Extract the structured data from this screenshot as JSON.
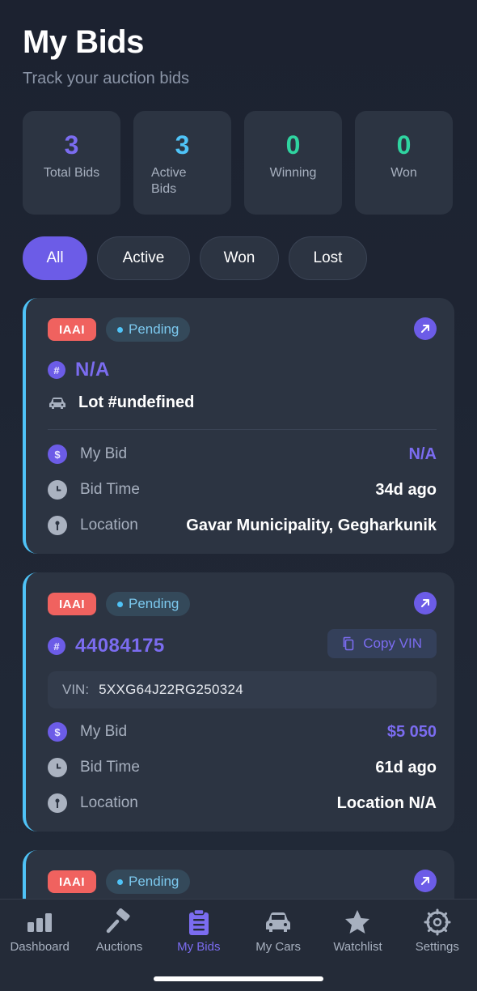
{
  "header": {
    "title": "My Bids",
    "subtitle": "Track your auction bids"
  },
  "stats": [
    {
      "value": "3",
      "label": "Total Bids",
      "color": "#7b6cf0"
    },
    {
      "value": "3",
      "label": "Active Bids",
      "color": "#4fc3f7"
    },
    {
      "value": "0",
      "label": "Winning",
      "color": "#2fd4a0"
    },
    {
      "value": "0",
      "label": "Won",
      "color": "#2fd4a0"
    }
  ],
  "filters": {
    "all": "All",
    "active": "Active",
    "won": "Won",
    "lost": "Lost",
    "selected": "All"
  },
  "bids": [
    {
      "auction": "IAAI",
      "status": "Pending",
      "id": "N/A",
      "lot": "Lot #undefined",
      "my_bid_label": "My Bid",
      "my_bid": "N/A",
      "bid_time_label": "Bid Time",
      "bid_time": "34d ago",
      "location_label": "Location",
      "location": "Gavar Municipality, Gegharkunik"
    },
    {
      "auction": "IAAI",
      "status": "Pending",
      "id": "44084175",
      "copy_label": "Copy VIN",
      "vin_label": "VIN:",
      "vin": "5XXG64J22RG250324",
      "my_bid_label": "My Bid",
      "my_bid": "$5 050",
      "bid_time_label": "Bid Time",
      "bid_time": "61d ago",
      "location_label": "Location",
      "location": "Location N/A"
    },
    {
      "auction": "IAAI",
      "status": "Pending"
    }
  ],
  "tabbar": {
    "items": [
      {
        "label": "Dashboard",
        "icon": "bar-chart-icon"
      },
      {
        "label": "Auctions",
        "icon": "gavel-icon"
      },
      {
        "label": "My Bids",
        "icon": "clipboard-icon"
      },
      {
        "label": "My Cars",
        "icon": "car-icon"
      },
      {
        "label": "Watchlist",
        "icon": "star-icon"
      },
      {
        "label": "Settings",
        "icon": "gear-icon"
      }
    ],
    "active": "My Bids"
  },
  "colors": {
    "accent": "#6c5ce7",
    "status_blue": "#4fc3f7",
    "badge_red": "#f0625f",
    "green": "#2fd4a0"
  }
}
